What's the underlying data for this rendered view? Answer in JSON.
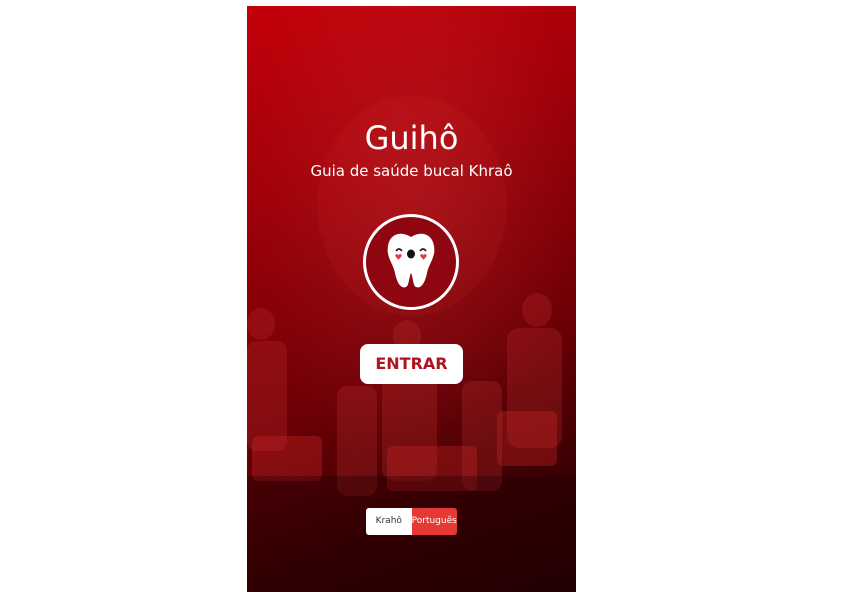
{
  "app": {
    "title": "Guihô",
    "subtitle": "Guia de saúde bucal Khraô"
  },
  "logo": {
    "icon": "tooth-mascot-icon"
  },
  "enter_button": {
    "label": "ENTRAR"
  },
  "language_toggle": {
    "options": [
      "Krahô",
      "Português"
    ],
    "selected": "Português"
  },
  "colors": {
    "background_top": "#c4000a",
    "background_bottom": "#240002",
    "button_text": "#b01420",
    "toggle_active": "#e53935"
  }
}
